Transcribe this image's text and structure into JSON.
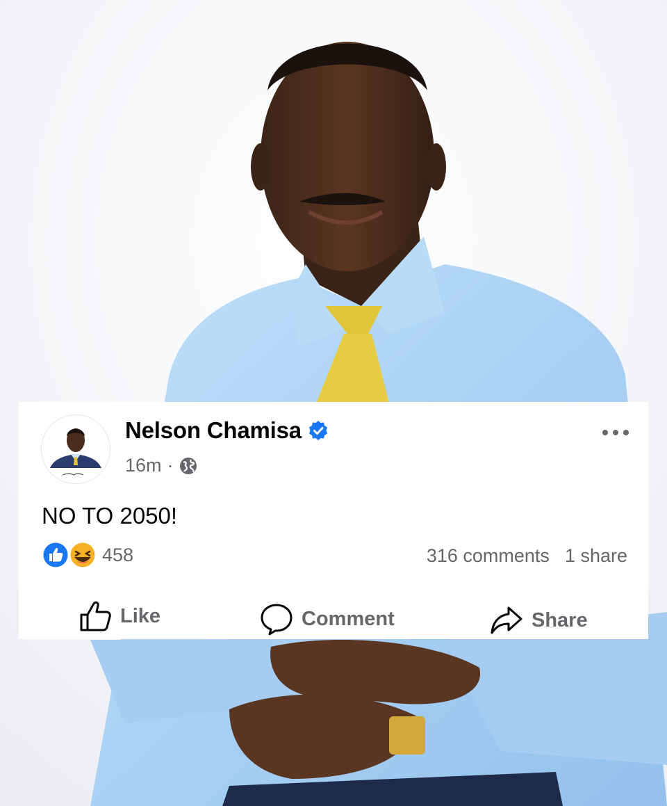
{
  "post": {
    "author": "Nelson Chamisa",
    "verified_icon": "verified-badge-icon",
    "time": "16m",
    "separator": "·",
    "audience_icon": "globe-icon",
    "text": "NO TO 2050!",
    "reactions": {
      "icons": [
        "like-reaction-icon",
        "haha-reaction-icon"
      ],
      "count": "458"
    },
    "comments": "316 comments",
    "shares": "1 share",
    "actions": {
      "like": "Like",
      "comment": "Comment",
      "share": "Share"
    }
  },
  "colors": {
    "text": "#050505",
    "secondary": "#65676b",
    "brand_blue": "#1877f2",
    "verified_blue": "#1877f2",
    "shirt": "#a9cff2",
    "tie": "#e2c53a"
  }
}
